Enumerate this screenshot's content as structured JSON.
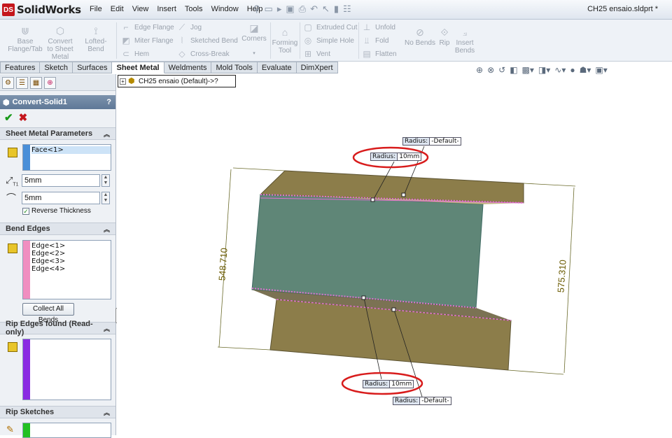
{
  "app": {
    "logo_prefix": "DS",
    "logo_text": "SolidWorks",
    "document_title": "CH25 ensaio.sldprt *"
  },
  "menus": [
    "File",
    "Edit",
    "View",
    "Insert",
    "Tools",
    "Window",
    "Help"
  ],
  "ribbon": {
    "base_flange": "Base Flange/Tab",
    "convert": "Convert to Sheet Metal",
    "lofted_bend": "Lofted-Bend",
    "edge_flange": "Edge Flange",
    "miter_flange": "Miter Flange",
    "hem": "Hem",
    "jog": "Jog",
    "sketched_bend": "Sketched Bend",
    "cross_break": "Cross-Break",
    "corners": "Corners",
    "forming_tool": "Forming Tool",
    "extruded_cut": "Extruded Cut",
    "simple_hole": "Simple Hole",
    "vent": "Vent",
    "unfold": "Unfold",
    "fold": "Fold",
    "flatten": "Flatten",
    "no_bends": "No Bends",
    "rip": "Rip",
    "insert_bends": "Insert Bends"
  },
  "tabs": [
    {
      "label": "Features",
      "active": false
    },
    {
      "label": "Sketch",
      "active": false
    },
    {
      "label": "Surfaces",
      "active": false
    },
    {
      "label": "Sheet Metal",
      "active": true
    },
    {
      "label": "Weldments",
      "active": false
    },
    {
      "label": "Mold Tools",
      "active": false
    },
    {
      "label": "Evaluate",
      "active": false
    },
    {
      "label": "DimXpert",
      "active": false
    }
  ],
  "tree": {
    "label": "CH25 ensaio  (Default)->?"
  },
  "pm": {
    "title": "Convert-Solid1",
    "help": "?",
    "ok": "✔",
    "cancel": "✖",
    "params_header": "Sheet Metal Parameters",
    "face_item": "Face<1>",
    "thickness": "5mm",
    "radius": "5mm",
    "thickness_subscript": "T1",
    "reverse_label": "Reverse Thickness",
    "reverse_checked": true,
    "bend_edges_header": "Bend Edges",
    "edges": [
      "Edge<1>",
      "Edge<2>",
      "Edge<3>",
      "Edge<4>"
    ],
    "collect_label": "Collect All Bends",
    "rip_found_header": "Rip Edges found (Read-only)",
    "rip_sketches_header": "Rip Sketches",
    "colors": {
      "face_stripe": "#4a8fd8",
      "edges_stripe": "#f08ec0",
      "rip_stripe": "#8a2be2",
      "sketch_stripe": "#22c022"
    }
  },
  "model": {
    "dim_left": "548.710",
    "dim_right": "575.310",
    "callouts": {
      "top_default": {
        "label": "Radius:",
        "value": "-Default-"
      },
      "top_radius": {
        "label": "Radius:",
        "value": "10mm"
      },
      "bottom_radius": {
        "label": "Radius:",
        "value": "10mm"
      },
      "bottom_default": {
        "label": "Radius:",
        "value": "-Default-"
      }
    },
    "colors": {
      "flange": "#8c7d4a",
      "web": "#5f8677",
      "bend_line": "#e070d0",
      "highlight": "#d81c1c"
    }
  }
}
